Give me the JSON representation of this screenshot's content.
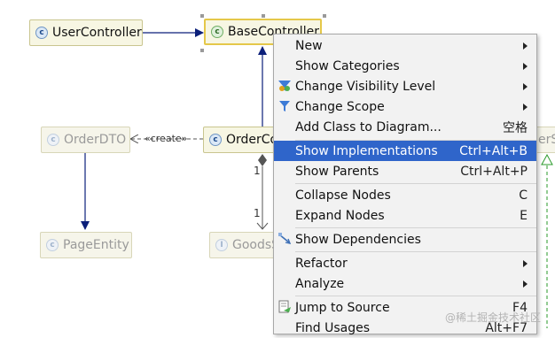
{
  "diagram": {
    "nodes": {
      "user_controller": "UserController",
      "base_controller": "BaseController",
      "order_dto": "OrderDTO",
      "order_controller": "OrderCo",
      "page_entity": "PageEntity",
      "goods": "GoodsS",
      "partial_right": "erS",
      "class_icon": "c",
      "interface_icon": "I"
    },
    "edge_labels": {
      "create": "«create»",
      "mult_top": "1",
      "mult_bottom": "1"
    }
  },
  "context_menu": {
    "items": [
      {
        "label": "New",
        "shortcut": "",
        "submenu": true,
        "icon": ""
      },
      {
        "label": "Show Categories",
        "shortcut": "",
        "submenu": true,
        "icon": ""
      },
      {
        "label": "Change Visibility Level",
        "shortcut": "",
        "submenu": true,
        "icon": "visibility-filter-icon"
      },
      {
        "label": "Change Scope",
        "shortcut": "",
        "submenu": true,
        "icon": "filter-icon"
      },
      {
        "label": "Add Class to Diagram...",
        "shortcut": "空格",
        "submenu": false,
        "icon": ""
      },
      {
        "label": "Show Implementations",
        "shortcut": "Ctrl+Alt+B",
        "submenu": false,
        "icon": "",
        "active": true
      },
      {
        "label": "Show Parents",
        "shortcut": "Ctrl+Alt+P",
        "submenu": false,
        "icon": ""
      },
      {
        "label": "Collapse Nodes",
        "shortcut": "C",
        "submenu": false,
        "icon": ""
      },
      {
        "label": "Expand Nodes",
        "shortcut": "E",
        "submenu": false,
        "icon": ""
      },
      {
        "label": "Show Dependencies",
        "shortcut": "",
        "submenu": false,
        "icon": "dependencies-icon"
      },
      {
        "label": "Refactor",
        "shortcut": "",
        "submenu": true,
        "icon": ""
      },
      {
        "label": "Analyze",
        "shortcut": "",
        "submenu": true,
        "icon": ""
      },
      {
        "label": "Jump to Source",
        "shortcut": "F4",
        "submenu": false,
        "icon": "jump-to-source-icon"
      },
      {
        "label": "Find Usages",
        "shortcut": "Alt+F7",
        "submenu": false,
        "icon": ""
      }
    ]
  },
  "watermark": "@稀土掘金技术社区",
  "colors": {
    "selection": "#2f65ca",
    "node_fill": "#f7f6e3",
    "selected_border": "#e5c84a",
    "edge_blue": "#0b1f7a",
    "dashed_green": "#2a9a2a"
  }
}
